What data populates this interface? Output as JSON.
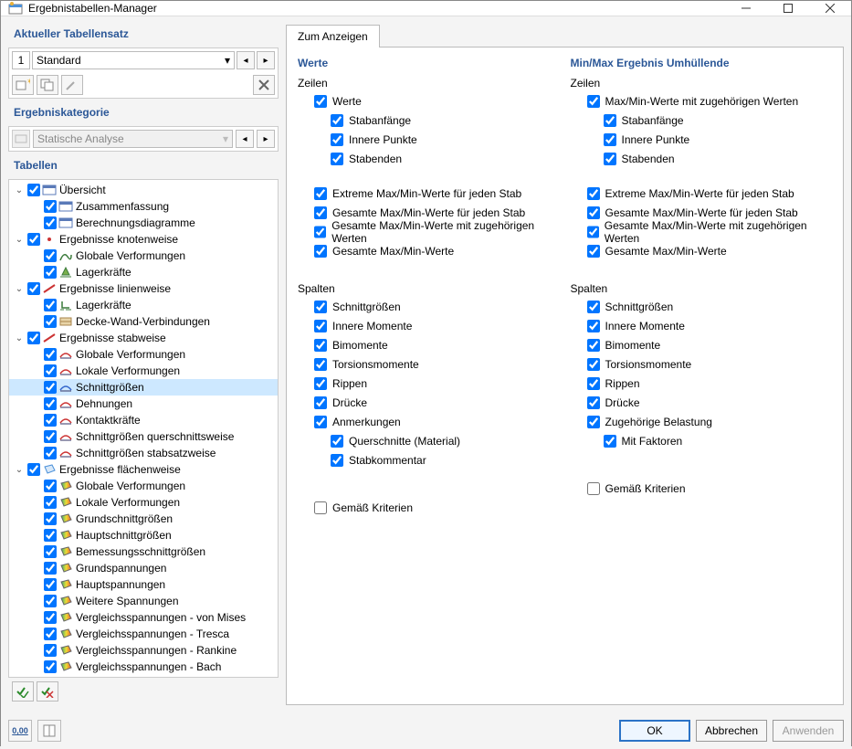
{
  "window": {
    "title": "Ergebnistabellen-Manager"
  },
  "tableset": {
    "label": "Aktueller Tabellensatz",
    "index": "1",
    "name": "Standard"
  },
  "category": {
    "label": "Ergebniskategorie",
    "value": "Statische Analyse"
  },
  "tables_label": "Tabellen",
  "tree": [
    {
      "d": 0,
      "exp": "open",
      "icon": "overview",
      "cb": true,
      "label": "Übersicht"
    },
    {
      "d": 1,
      "icon": "overview",
      "cb": true,
      "label": "Zusammenfassung"
    },
    {
      "d": 1,
      "icon": "overview",
      "cb": true,
      "label": "Berechnungsdiagramme"
    },
    {
      "d": 0,
      "exp": "open",
      "icon": "node",
      "cb": true,
      "label": "Ergebnisse knotenweise"
    },
    {
      "d": 1,
      "icon": "deform",
      "cb": true,
      "label": "Globale Verformungen"
    },
    {
      "d": 1,
      "icon": "support",
      "cb": true,
      "label": "Lagerkräfte"
    },
    {
      "d": 0,
      "exp": "open",
      "icon": "line",
      "cb": true,
      "label": "Ergebnisse linienweise"
    },
    {
      "d": 1,
      "icon": "support2",
      "cb": true,
      "label": "Lagerkräfte"
    },
    {
      "d": 1,
      "icon": "wall",
      "cb": true,
      "label": "Decke-Wand-Verbindungen"
    },
    {
      "d": 0,
      "exp": "open",
      "icon": "member",
      "cb": true,
      "label": "Ergebnisse stabweise"
    },
    {
      "d": 1,
      "icon": "mdef",
      "cb": true,
      "label": "Globale Verformungen"
    },
    {
      "d": 1,
      "icon": "mdef",
      "cb": true,
      "label": "Lokale Verformungen"
    },
    {
      "d": 1,
      "icon": "mforce",
      "cb": true,
      "label": "Schnittgrößen",
      "sel": true
    },
    {
      "d": 1,
      "icon": "mdef",
      "cb": true,
      "label": "Dehnungen"
    },
    {
      "d": 1,
      "icon": "mdef",
      "cb": true,
      "label": "Kontaktkräfte"
    },
    {
      "d": 1,
      "icon": "mdef",
      "cb": true,
      "label": "Schnittgrößen querschnittsweise"
    },
    {
      "d": 1,
      "icon": "mdef",
      "cb": true,
      "label": "Schnittgrößen stabsatzweise"
    },
    {
      "d": 0,
      "exp": "open",
      "icon": "surface",
      "cb": true,
      "label": "Ergebnisse flächenweise"
    },
    {
      "d": 1,
      "icon": "surf",
      "cb": true,
      "label": "Globale Verformungen"
    },
    {
      "d": 1,
      "icon": "surf",
      "cb": true,
      "label": "Lokale Verformungen"
    },
    {
      "d": 1,
      "icon": "surf",
      "cb": true,
      "label": "Grundschnittgrößen"
    },
    {
      "d": 1,
      "icon": "surf",
      "cb": true,
      "label": "Hauptschnittgrößen"
    },
    {
      "d": 1,
      "icon": "surf",
      "cb": true,
      "label": "Bemessungsschnittgrößen"
    },
    {
      "d": 1,
      "icon": "surf",
      "cb": true,
      "label": "Grundspannungen"
    },
    {
      "d": 1,
      "icon": "surf",
      "cb": true,
      "label": "Hauptspannungen"
    },
    {
      "d": 1,
      "icon": "surf",
      "cb": true,
      "label": "Weitere Spannungen"
    },
    {
      "d": 1,
      "icon": "surf",
      "cb": true,
      "label": "Vergleichsspannungen - von Mises"
    },
    {
      "d": 1,
      "icon": "surf",
      "cb": true,
      "label": "Vergleichsspannungen - Tresca"
    },
    {
      "d": 1,
      "icon": "surf",
      "cb": true,
      "label": "Vergleichsspannungen - Rankine"
    },
    {
      "d": 1,
      "icon": "surf",
      "cb": true,
      "label": "Vergleichsspannungen - Bach"
    }
  ],
  "tab": "Zum Anzeigen",
  "left_col": {
    "title": "Werte",
    "rows_hdr": "Zeilen",
    "rows": [
      {
        "label": "Werte",
        "cb": true,
        "ind": 1
      },
      {
        "label": "Stabanfänge",
        "cb": true,
        "ind": 2
      },
      {
        "label": "Innere Punkte",
        "cb": true,
        "ind": 2
      },
      {
        "label": "Stabenden",
        "cb": true,
        "ind": 2
      }
    ],
    "rows2": [
      {
        "label": "Extreme Max/Min-Werte für jeden Stab",
        "cb": true
      },
      {
        "label": "Gesamte Max/Min-Werte für jeden Stab",
        "cb": true
      },
      {
        "label": "Gesamte Max/Min-Werte mit zugehörigen Werten",
        "cb": true
      },
      {
        "label": "Gesamte Max/Min-Werte",
        "cb": true
      }
    ],
    "cols_hdr": "Spalten",
    "cols": [
      {
        "label": "Schnittgrößen",
        "cb": true
      },
      {
        "label": "Innere Momente",
        "cb": true
      },
      {
        "label": "Bimomente",
        "cb": true
      },
      {
        "label": "Torsionsmomente",
        "cb": true
      },
      {
        "label": "Rippen",
        "cb": true
      },
      {
        "label": "Drücke",
        "cb": true
      },
      {
        "label": "Anmerkungen",
        "cb": true
      },
      {
        "label": "Querschnitte (Material)",
        "cb": true,
        "ind": 2
      },
      {
        "label": "Stabkommentar",
        "cb": true,
        "ind": 2
      }
    ],
    "criteria": {
      "label": "Gemäß Kriterien",
      "cb": false
    }
  },
  "right_col": {
    "title": "Min/Max Ergebnis Umhüllende",
    "rows_hdr": "Zeilen",
    "rows": [
      {
        "label": "Max/Min-Werte mit zugehörigen Werten",
        "cb": true,
        "ind": 1
      },
      {
        "label": "Stabanfänge",
        "cb": true,
        "ind": 2
      },
      {
        "label": "Innere Punkte",
        "cb": true,
        "ind": 2
      },
      {
        "label": "Stabenden",
        "cb": true,
        "ind": 2
      }
    ],
    "rows2": [
      {
        "label": "Extreme Max/Min-Werte für jeden Stab",
        "cb": true
      },
      {
        "label": "Gesamte Max/Min-Werte für jeden Stab",
        "cb": true
      },
      {
        "label": "Gesamte Max/Min-Werte mit zugehörigen Werten",
        "cb": true
      },
      {
        "label": "Gesamte Max/Min-Werte",
        "cb": true
      }
    ],
    "cols_hdr": "Spalten",
    "cols": [
      {
        "label": "Schnittgrößen",
        "cb": true
      },
      {
        "label": "Innere Momente",
        "cb": true
      },
      {
        "label": "Bimomente",
        "cb": true
      },
      {
        "label": "Torsionsmomente",
        "cb": true
      },
      {
        "label": "Rippen",
        "cb": true
      },
      {
        "label": "Drücke",
        "cb": true
      },
      {
        "label": "Zugehörige Belastung",
        "cb": true
      },
      {
        "label": "Mit Faktoren",
        "cb": true,
        "ind": 2
      }
    ],
    "criteria": {
      "label": "Gemäß Kriterien",
      "cb": false
    }
  },
  "buttons": {
    "ok": "OK",
    "cancel": "Abbrechen",
    "apply": "Anwenden"
  }
}
